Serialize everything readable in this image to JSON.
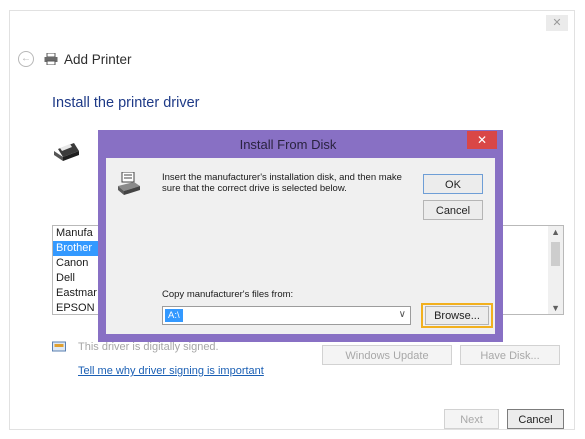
{
  "window": {
    "title": "Add Printer",
    "close_glyph": "✕",
    "back_icon": "back-arrow-icon",
    "section_title": "Install the printer driver",
    "manufacturers": [
      "Manufa",
      "Brother",
      "Canon",
      "Dell",
      "Eastmar",
      "EPSON"
    ],
    "selected_manufacturer_index": 1,
    "signing_text": "This driver is digitally signed.",
    "signing_link": "Tell me why driver signing is important",
    "windows_update_label": "Windows Update",
    "have_disk_label": "Have Disk...",
    "next_label": "Next",
    "cancel_label": "Cancel"
  },
  "dialog": {
    "title": "Install From Disk",
    "close_glyph": "✕",
    "message": "Insert the manufacturer's installation disk, and then make sure that the correct drive is selected below.",
    "ok_label": "OK",
    "cancel_label": "Cancel",
    "copy_label": "Copy manufacturer's files from:",
    "path_value": "A:\\",
    "browse_label": "Browse..."
  },
  "colors": {
    "dialog_frame": "#8870c4",
    "close_button": "#d94747",
    "selection": "#3399ff",
    "link": "#1a5fb4",
    "focus_highlight": "#f2b01e"
  }
}
